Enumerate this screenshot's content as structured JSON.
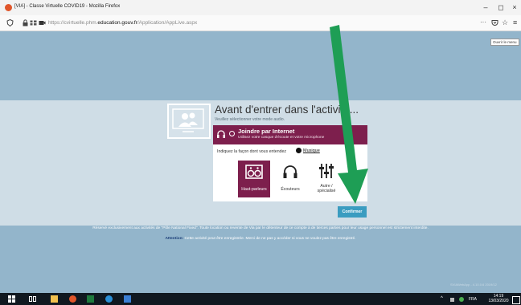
{
  "browser": {
    "window_title": "[VIA] - Classe Virtuelle COVID19 - Mozilla Firefox",
    "url_prefix": "https://cvirtuelle.phm.",
    "url_domain": "education.gouv.fr",
    "url_path": "/Application/AppLive.aspx",
    "minimize": "–",
    "maximize": "◻",
    "close": "×",
    "menu_glyph": "···",
    "tooltip": "Ouvrir le menu"
  },
  "page": {
    "heading": "Avant d'entrer dans l'activité...",
    "subheading": "Veuillez sélectionner votre mode audio.",
    "dialog": {
      "title": "Joindre par Internet",
      "subtitle": "Utilisez votre casque d'écoute et votre microphone",
      "instruction": "Indiquez la façon dont vous entendez",
      "music_label": "Musique",
      "options": [
        {
          "label": "Haut-parleurs",
          "selected": true
        },
        {
          "label": "Écouteurs",
          "selected": false
        },
        {
          "label_line1": "Autre /",
          "label_line2": "spécialisé",
          "selected": false
        }
      ],
      "confirm_label": "Confirmer"
    },
    "legal_line1": "Réservé exclusivement aux activités de \"Pôle National Fixed\". Toute location ou revente de Via par le détenteur de ce compte à de tierces parties pour leur usage personnel est strictement interdite.",
    "legal_attention": "Attention:",
    "legal_line2": "Cette activité peut être enregistrée. Merci de ne pas y accéder si vous ne voulez pas être enregistré.",
    "version": "SVIAWebApp - 4.10.0.6 2019/12",
    "colors": {
      "accent": "#7d1f4d",
      "confirm": "#3a9cc0",
      "arrow": "#1e9e55",
      "page_bg": "#93b5cb"
    }
  },
  "taskbar": {
    "language": "FRA",
    "time": "14:19",
    "date": "13/03/2020"
  }
}
